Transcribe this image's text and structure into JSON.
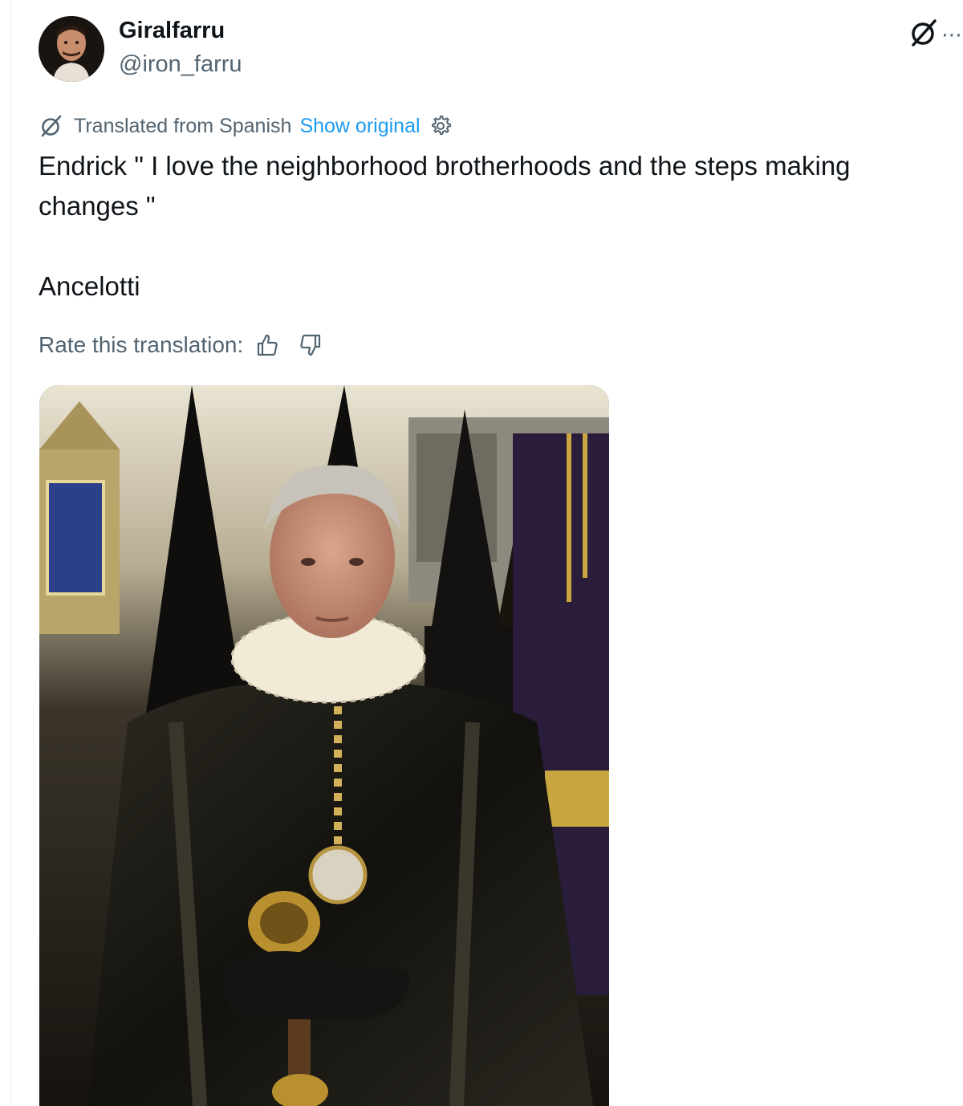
{
  "author": {
    "display_name": "Giralfarru",
    "handle": "@iron_farru"
  },
  "translation": {
    "notice": "Translated from Spanish",
    "show_original": "Show original"
  },
  "post": {
    "line1": "Endrick \" I love the neighborhood brotherhoods and the steps making changes \"",
    "line2": "Ancelotti"
  },
  "rating": {
    "label": "Rate this translation:"
  },
  "icons": {
    "translate": "translate-icon",
    "grok": "grok-icon",
    "more": "more-icon",
    "settings": "gear-icon",
    "like": "thumbs-up-icon",
    "dislike": "thumbs-down-icon"
  },
  "colors": {
    "link": "#1d9bf0",
    "muted": "#536471",
    "text": "#0f1419"
  }
}
